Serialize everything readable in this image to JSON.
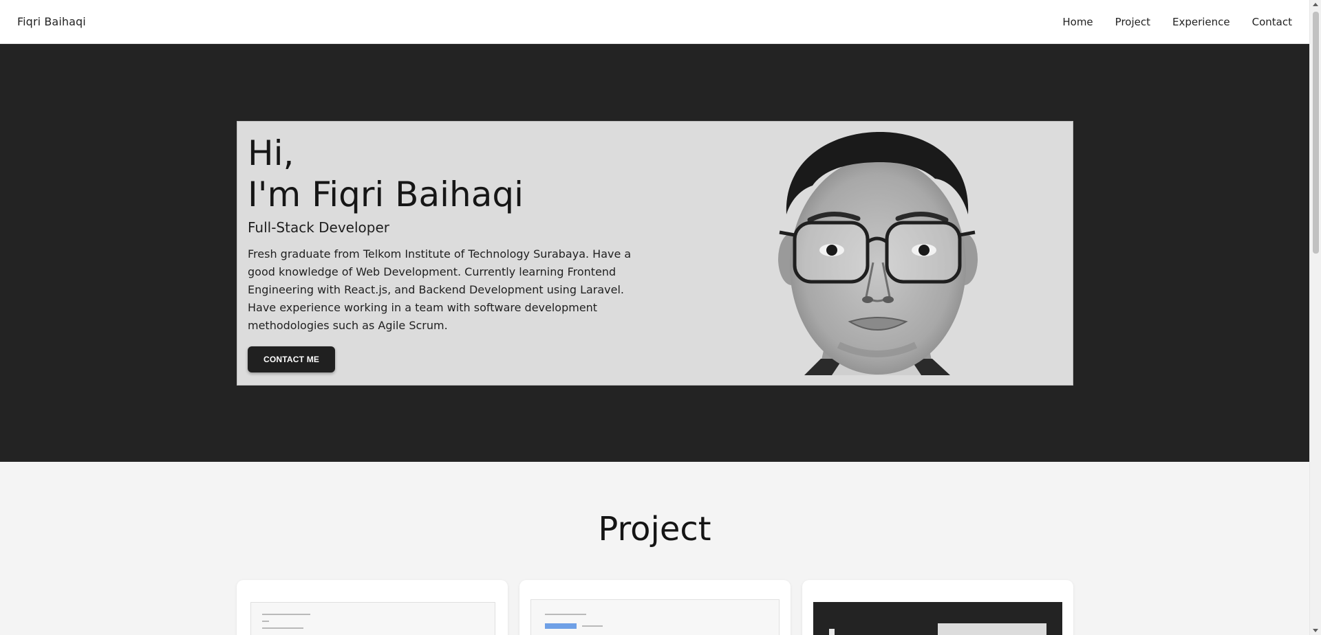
{
  "brand": "Fiqri Baihaqi",
  "nav": {
    "items": [
      "Home",
      "Project",
      "Experience",
      "Contact"
    ]
  },
  "hero": {
    "greeting": "Hi,",
    "name": "I'm Fiqri Baihaqi",
    "role": "Full-Stack Developer",
    "description": "Fresh graduate from Telkom Institute of Technology Surabaya. Have a good knowledge of Web Development. Currently learning Frontend Engineering with React.js, and Backend Development using Laravel. Have experience working in a team with software development methodologies such as Agile Scrum.",
    "cta_label": "CONTACT ME"
  },
  "project": {
    "title": "Project"
  },
  "colors": {
    "hero_bg": "#232323",
    "card_bg": "#dcdcdc",
    "button_bg": "#202020",
    "page_bg": "#f4f4f4"
  }
}
